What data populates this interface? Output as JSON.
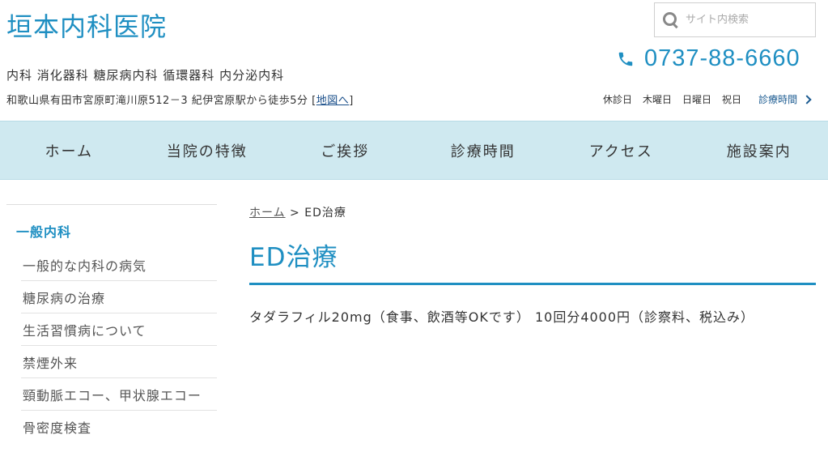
{
  "header": {
    "title": "垣本内科医院",
    "departments": "内科 消化器科 糖尿病内科 循環器科 内分泌内科",
    "address": "和歌山県有田市宮原町滝川原512－3 紀伊宮原駅から徒歩5分",
    "map_link_open": "[",
    "map_link": "地図へ",
    "map_link_close": "]",
    "search_placeholder": "サイト内検索",
    "phone": "0737-88-6660",
    "closed_label": "休診日",
    "closed_days": [
      "木曜日",
      "日曜日",
      "祝日"
    ],
    "hours_link": "診療時間",
    "accent_color": "#1f8fc2"
  },
  "nav": {
    "items": [
      "ホーム",
      "当院の特徴",
      "ご挨拶",
      "診療時間",
      "アクセス",
      "施設案内"
    ],
    "background": "#cfe9f0"
  },
  "sidebar": {
    "heading": "一般内科",
    "items": [
      "一般的な内科の病気",
      "糖尿病の治療",
      "生活習慣病について",
      "禁煙外来",
      "頸動脈エコー、甲状腺エコー",
      "骨密度検査"
    ]
  },
  "main": {
    "breadcrumb_home": "ホーム",
    "breadcrumb_separator": ">",
    "breadcrumb_current": "ED治療",
    "title": "ED治療",
    "content": "タダラフィル20mg（食事、飲酒等OKです） 10回分4000円（診察料、税込み）"
  }
}
